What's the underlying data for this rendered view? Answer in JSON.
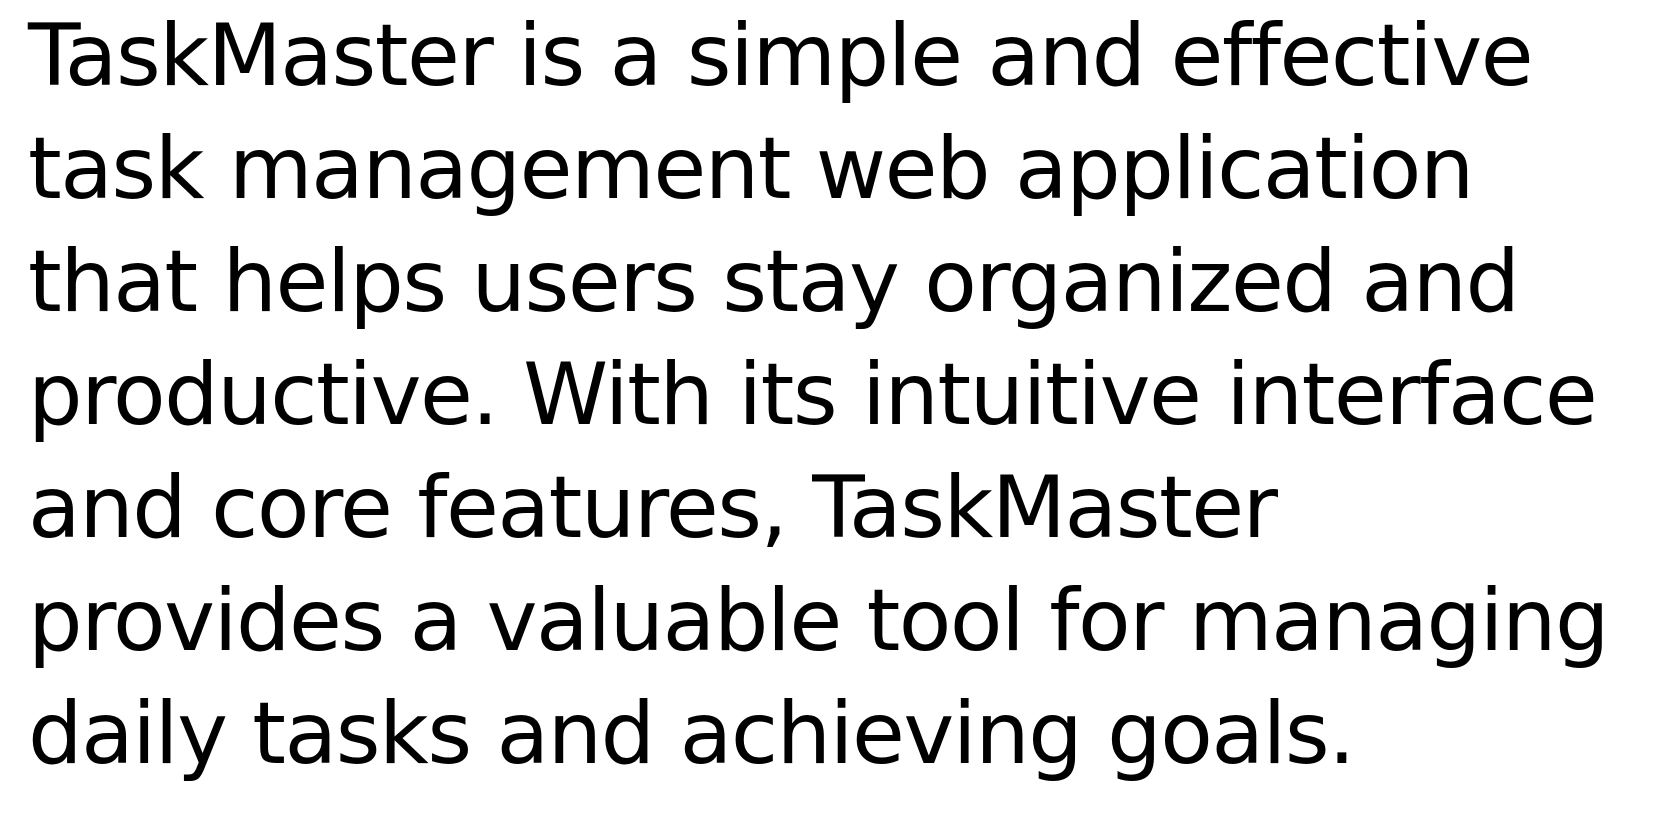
{
  "document": {
    "lines": [
      "TaskMaster is a simple and effective",
      "task management web application",
      "that helps users stay organized and",
      "productive. With its intuitive interface",
      "and core features, TaskMaster",
      "provides a valuable tool for managing",
      "daily tasks and achieving goals."
    ]
  },
  "colors": {
    "background": "#ffffff",
    "text": "#000000"
  }
}
